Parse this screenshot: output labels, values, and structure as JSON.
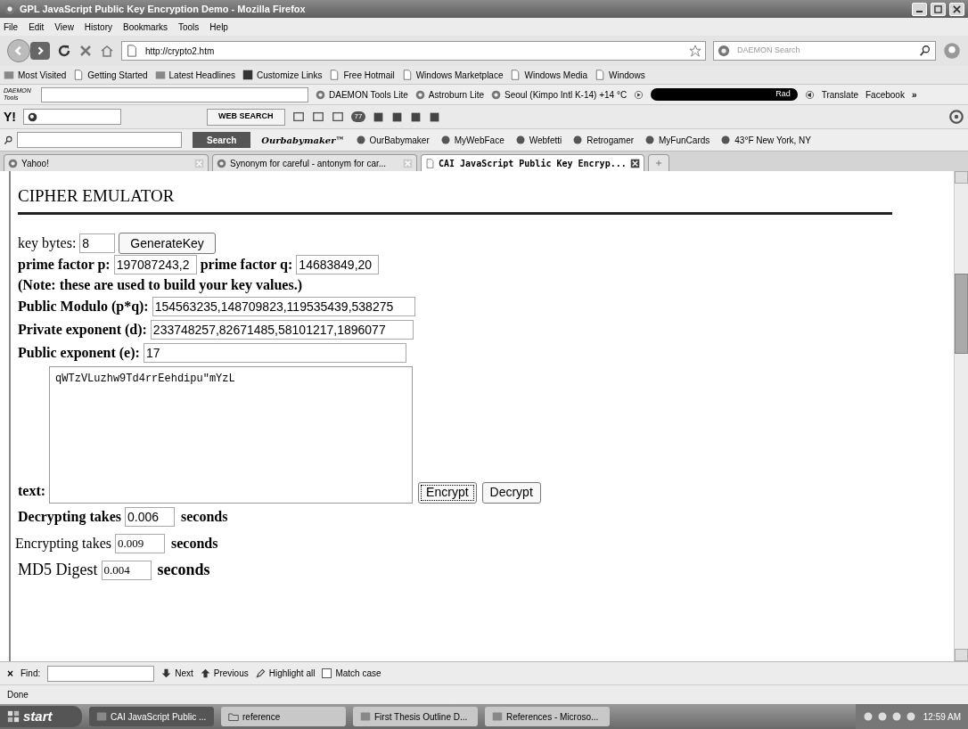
{
  "window": {
    "title": "GPL JavaScript Public Key Encryption Demo - Mozilla Firefox"
  },
  "menu": [
    "File",
    "Edit",
    "View",
    "History",
    "Bookmarks",
    "Tools",
    "Help"
  ],
  "navigation": {
    "url": "http://crypto2.htm",
    "search_placeholder": "DAEMON Search"
  },
  "bookmarks": [
    "Most Visited",
    "Getting Started",
    "Latest Headlines",
    "Customize Links",
    "Free Hotmail",
    "Windows Marketplace",
    "Windows Media",
    "Windows"
  ],
  "daemon_toolbar": {
    "logo": "DAEMON Tools",
    "items": [
      "DAEMON Tools Lite",
      "Astroburn Lite",
      "Seoul (Kimpo Intl K-14) +14 °C"
    ],
    "radio": "Rad",
    "translate": "Translate",
    "facebook": "Facebook",
    "more": "»"
  },
  "yahoo_toolbar": {
    "logo": "Y!",
    "button": "WEB SEARCH",
    "badge": "77"
  },
  "search_toolbar": {
    "button": "Search",
    "brand": "Ourbabymaker™",
    "items": [
      "OurBabymaker",
      "MyWebFace",
      "Webfetti",
      "Retrogamer",
      "MyFunCards",
      "43°F New York, NY"
    ]
  },
  "tabs": [
    {
      "label": "Yahoo!",
      "selected": false
    },
    {
      "label": "Synonym for careful - antonym for car...",
      "selected": false
    },
    {
      "label": "CAI JavaScript Public Key Encryp...",
      "selected": true
    }
  ],
  "page": {
    "heading": "CIPHER EMULATOR",
    "key_bytes": {
      "label": "key bytes:",
      "value": "8",
      "button": "GenerateKey"
    },
    "prime_p": {
      "label": "prime factor p:",
      "value": "197087243,2"
    },
    "prime_q": {
      "label": "prime factor q:",
      "value": "14683849,20"
    },
    "note": "(Note: these are used to build your key values.)",
    "fields": [
      {
        "label": "Public Modulo (p*q):",
        "value": "154563235,148709823,119535439,538275"
      },
      {
        "label": "Private exponent (d):",
        "value": "233748257,82671485,58101217,1896077"
      },
      {
        "label": "Public exponent (e):",
        "value": "17"
      }
    ],
    "text": {
      "label": "text:",
      "value": "qWTzVLuzhw9Td4rrEehdipu\"mYzL"
    },
    "actions": [
      {
        "label": "Encrypt",
        "focused": true
      },
      {
        "label": "Decrypt",
        "focused": false
      }
    ],
    "timings": [
      {
        "label": "Decrypting takes",
        "value": "0.006",
        "unit": "seconds",
        "bold": true
      },
      {
        "label": "Encrypting takes",
        "value": "0.009",
        "unit": "seconds",
        "bold": false
      },
      {
        "label": "MD5 Digest",
        "value": "0.004",
        "unit": "seconds",
        "bold": false
      }
    ]
  },
  "find_bar": {
    "close": "×",
    "label": "Find:",
    "next": "Next",
    "previous": "Previous",
    "highlight": "Highlight all",
    "match_case": {
      "label": "Match case",
      "checked": false
    }
  },
  "status_bar": "Done",
  "taskbar": {
    "start": "start",
    "items": [
      {
        "label": "CAI JavaScript Public ...",
        "selected": true
      },
      {
        "label": "reference",
        "selected": false
      },
      {
        "label": "First Thesis Outline D...",
        "selected": false
      },
      {
        "label": "References - Microso...",
        "selected": false
      }
    ],
    "clock": "12:59 AM"
  }
}
